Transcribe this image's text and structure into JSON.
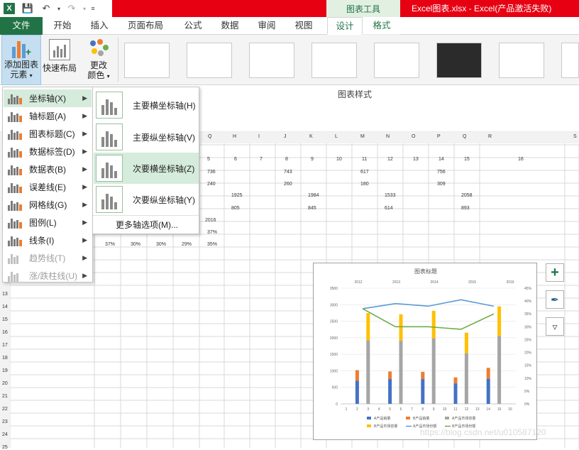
{
  "titlebar": {
    "context_group": "图表工具",
    "window_title": "Excel图表.xlsx -  Excel(产品激活失败)"
  },
  "tabs": {
    "file": "文件",
    "home": "开始",
    "insert": "插入",
    "page_layout": "页面布局",
    "formulas": "公式",
    "data": "数据",
    "review": "审阅",
    "view": "视图",
    "design": "设计",
    "format": "格式"
  },
  "ribbon": {
    "add_element_line1": "添加图表",
    "add_element_line2": "元素",
    "quick_layout": "快速布局",
    "change_colors_line1": "更改",
    "change_colors_line2": "颜色",
    "chart_styles_group": "图表样式"
  },
  "menu": {
    "items": [
      {
        "label": "坐标轴(X)",
        "enabled": true
      },
      {
        "label": "轴标题(A)",
        "enabled": true
      },
      {
        "label": "图表标题(C)",
        "enabled": true
      },
      {
        "label": "数据标签(D)",
        "enabled": true
      },
      {
        "label": "数据表(B)",
        "enabled": true
      },
      {
        "label": "误差线(E)",
        "enabled": true
      },
      {
        "label": "网格线(G)",
        "enabled": true
      },
      {
        "label": "图例(L)",
        "enabled": true
      },
      {
        "label": "线条(I)",
        "enabled": true
      },
      {
        "label": "趋势线(T)",
        "enabled": false
      },
      {
        "label": "涨/跌柱线(U)",
        "enabled": false
      }
    ]
  },
  "submenu": {
    "items": [
      {
        "label": "主要横坐标轴(H)"
      },
      {
        "label": "主要纵坐标轴(V)"
      },
      {
        "label": "次要横坐标轴(Z)"
      },
      {
        "label": "次要纵坐标轴(Y)"
      }
    ],
    "more": "更多轴选项(M)..."
  },
  "sheet": {
    "columns": [
      "Q",
      "H",
      "I",
      "J",
      "K",
      "L",
      "M",
      "N",
      "O",
      "P",
      "Q",
      "R",
      "S"
    ],
    "header_row_nums": [
      "5",
      "6",
      "7",
      "8",
      "9",
      "10",
      "11",
      "12",
      "13",
      "14",
      "15",
      "16"
    ],
    "row1": [
      "736",
      "743",
      "617",
      "756"
    ],
    "row2": [
      "240",
      "260",
      "180",
      "309"
    ],
    "row3": [
      "1925",
      "1984",
      "1533",
      "2058"
    ],
    "row4": [
      "805",
      "845",
      "614",
      "893"
    ],
    "row5": [
      "2016"
    ],
    "row6": [
      "37%"
    ],
    "row7": [
      "37%",
      "30%",
      "30%",
      "29%",
      "35%"
    ],
    "row_numbers": [
      "13",
      "14",
      "15",
      "16",
      "17",
      "18",
      "19",
      "20",
      "21",
      "22",
      "23",
      "24",
      "25"
    ]
  },
  "chart_data": {
    "type": "bar",
    "title": "图表标题",
    "top_axis_labels": [
      "2012",
      "2013",
      "2014",
      "2015",
      "2016"
    ],
    "x": [
      "1",
      "2",
      "3",
      "4",
      "5",
      "6",
      "7",
      "8",
      "9",
      "10",
      "11",
      "12",
      "13",
      "14",
      "15",
      "16"
    ],
    "y_left_ticks": [
      "0",
      "500",
      "1000",
      "1500",
      "2000",
      "2500",
      "3000",
      "3500"
    ],
    "y_right_ticks": [
      "0%",
      "5%",
      "10%",
      "15%",
      "20%",
      "25%",
      "30%",
      "35%",
      "40%",
      "45%"
    ],
    "ylim": [
      0,
      3500
    ],
    "y2lim": [
      0,
      0.45
    ],
    "bar_positions": [
      2,
      5,
      8,
      11,
      14
    ],
    "series": [
      {
        "name": "A产品销量",
        "color": "#4472c4",
        "values": [
          700,
          750,
          750,
          620,
          760
        ]
      },
      {
        "name": "B产品销量",
        "color": "#ed7d31",
        "values": [
          320,
          230,
          220,
          180,
          330
        ]
      },
      {
        "name": "A产品市场容量",
        "color": "#a5a5a5",
        "values": [
          1925,
          1910,
          1984,
          1533,
          2058
        ]
      },
      {
        "name": "B产品市场容量",
        "color": "#ffc000",
        "values": [
          820,
          800,
          830,
          620,
          890
        ]
      }
    ],
    "line_series": [
      {
        "name": "A产品市场份额",
        "color": "#5b9bd5",
        "x": [
          2,
          5,
          8,
          11,
          14
        ],
        "values": [
          0.37,
          0.39,
          0.38,
          0.405,
          0.38
        ]
      },
      {
        "name": "B产品市场份额",
        "color": "#70ad47",
        "x": [
          2,
          5,
          8,
          11,
          14
        ],
        "values": [
          0.37,
          0.3,
          0.3,
          0.29,
          0.35
        ]
      }
    ],
    "legend_placement": "bottom",
    "grid": true
  },
  "watermark": "https://blog.csdn.net/u010587120"
}
